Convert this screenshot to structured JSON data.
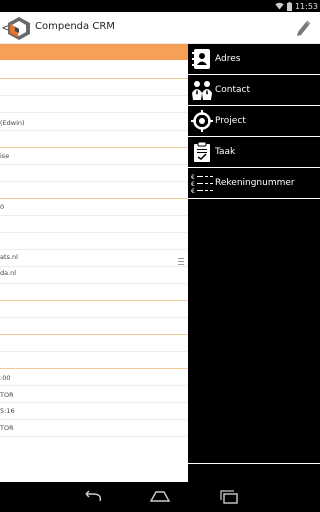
{
  "status_bar": {
    "time": "11:53",
    "icons": [
      "wifi-icon",
      "battery-icon"
    ]
  },
  "action_bar": {
    "title": "Compenda CRM",
    "up_caret": "<",
    "edit_icon": "pencil-icon"
  },
  "content": {
    "rows": [
      {
        "text": "(Edwin)"
      },
      {
        "text": "ise"
      },
      {
        "text": "0"
      },
      {
        "text": "ats.nl"
      },
      {
        "text": "da.nl"
      },
      {
        "text": ":00"
      },
      {
        "text": "TOR"
      },
      {
        "text": "5:16"
      },
      {
        "text": "TOR"
      }
    ]
  },
  "drawer": {
    "items": [
      {
        "label": "Adres",
        "icon": "address-book-icon"
      },
      {
        "label": "Contact",
        "icon": "contacts-icon"
      },
      {
        "label": "Project",
        "icon": "target-icon"
      },
      {
        "label": "Taak",
        "icon": "clipboard-icon"
      },
      {
        "label": "Rekeningnummer",
        "icon": "euro-list-icon"
      }
    ]
  },
  "nav_bar": {
    "buttons": [
      "back-icon",
      "home-icon",
      "recent-apps-icon"
    ]
  },
  "colors": {
    "accent": "#f5a054",
    "drawer_bg": "#000000",
    "drawer_text": "#ffffff"
  }
}
